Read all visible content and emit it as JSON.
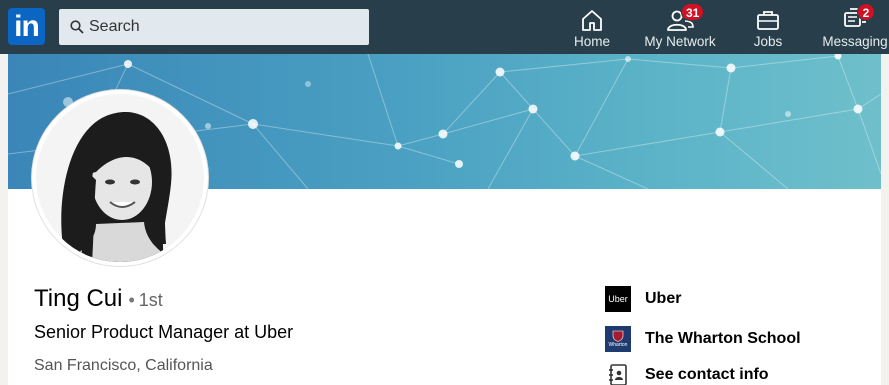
{
  "nav": {
    "logo_text": "in",
    "search_placeholder": "Search",
    "items": [
      {
        "label": "Home",
        "icon": "home-icon"
      },
      {
        "label": "My Network",
        "icon": "network-icon",
        "badge": "31"
      },
      {
        "label": "Jobs",
        "icon": "briefcase-icon"
      },
      {
        "label": "Messaging",
        "icon": "messaging-icon",
        "badge": "2"
      }
    ]
  },
  "profile": {
    "name": "Ting Cui",
    "separator": "•",
    "degree": "1st",
    "headline": "Senior Product Manager at Uber",
    "location": "San Francisco, California"
  },
  "sidebar": {
    "items": [
      {
        "label": "Uber",
        "logo_text": "Uber",
        "icon": "uber-logo"
      },
      {
        "label": "The Wharton School",
        "logo_text": "Wharton",
        "icon": "wharton-logo"
      },
      {
        "label": "See contact info",
        "icon": "contact-card-icon"
      }
    ]
  },
  "colors": {
    "nav_bg": "#283e4a",
    "brand": "#0a66c2",
    "badge": "#d11124",
    "banner": "#4aa0c2"
  }
}
